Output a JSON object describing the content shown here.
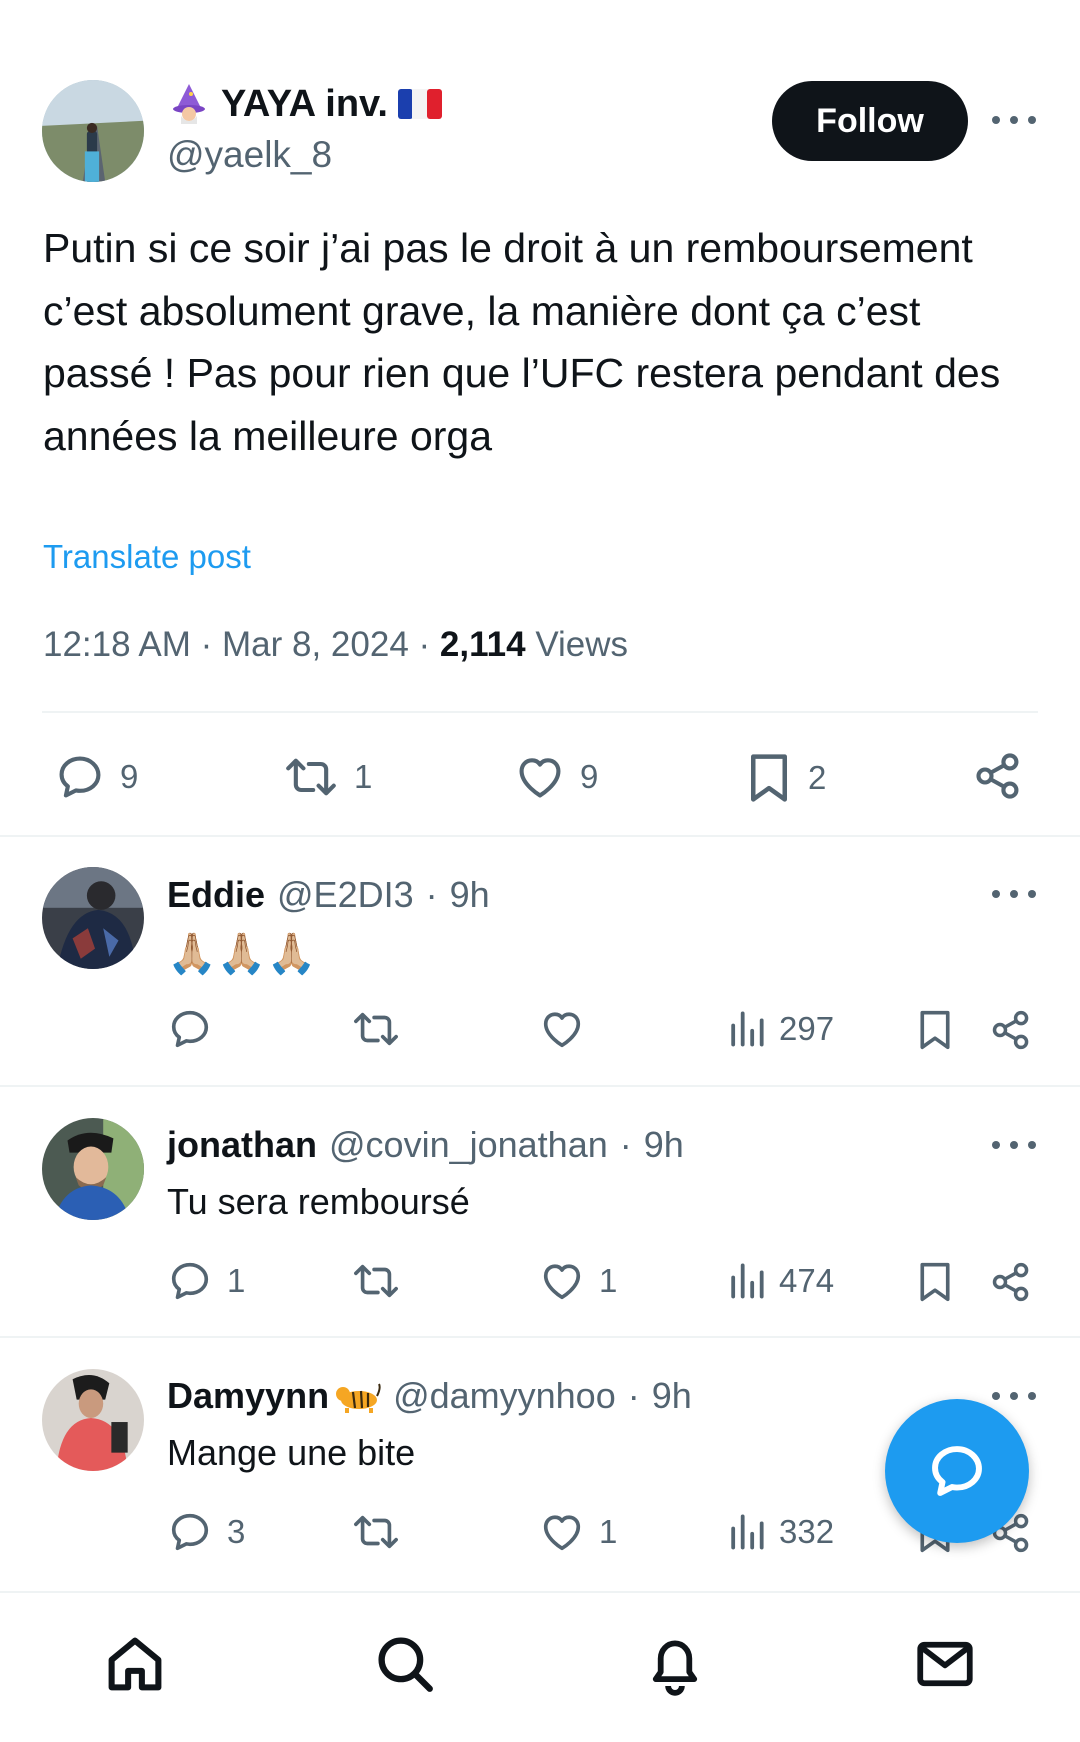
{
  "main_tweet": {
    "display_name": "YAYA inv.",
    "handle": "@yaelk_8",
    "follow_label": "Follow",
    "text": "Putin si ce soir j’ai pas le droit à un remboursement c’est absolument grave, la manière dont ça c’est passé ! Pas pour rien que l’UFC restera pendant des années la meilleure orga",
    "translate_label": "Translate post",
    "time": "12:18 AM",
    "date": "Mar 8, 2024",
    "views_count": "2,114",
    "views_label": "Views",
    "actions": {
      "replies": "9",
      "reposts": "1",
      "likes": "9",
      "bookmarks": "2"
    }
  },
  "replies": [
    {
      "display_name": "Eddie",
      "handle": "@E2DI3",
      "time": "9h",
      "text": "🙏🏼🙏🏼🙏🏼",
      "replies": "",
      "likes": "",
      "views": "297"
    },
    {
      "display_name": "jonathan",
      "handle": "@covin_jonathan",
      "time": "9h",
      "text": "Tu sera remboursé",
      "replies": "1",
      "likes": "1",
      "views": "474"
    },
    {
      "display_name": "Damyynn",
      "handle": "@damyynhoo",
      "time": "9h",
      "text": "Mange une bite",
      "replies": "3",
      "likes": "1",
      "views": "332"
    }
  ],
  "separator": "·",
  "colors": {
    "accent": "#1d9bf0",
    "text": "#0f1419",
    "secondary": "#536471",
    "divider": "#eff3f4"
  },
  "icons": {
    "reply": "reply-icon",
    "repost": "repost-icon",
    "like": "heart-icon",
    "bookmark": "bookmark-icon",
    "share": "share-icon",
    "views": "views-icon",
    "nav": [
      "home-icon",
      "search-icon",
      "bell-icon",
      "mail-icon"
    ]
  }
}
